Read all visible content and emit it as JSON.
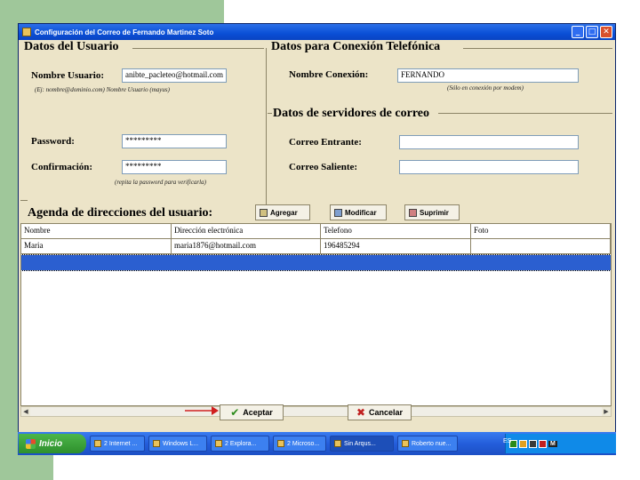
{
  "window": {
    "title": "Configuración del Correo de Fernando Martinez Soto",
    "buttons": {
      "minimize": "_",
      "maximize": "□",
      "close": "✕"
    }
  },
  "usuario": {
    "section_title": "Datos del Usuario",
    "nombre_label": "Nombre Usuario:",
    "nombre_value": "anibte_pacleteo@hotmail.com",
    "nombre_hint": "(Ej: nombre@dominio.com)          Nombre Usuario (mayus)",
    "password_label": "Password:",
    "password_value": "*********",
    "confirm_label": "Confirmación:",
    "confirm_value": "*********",
    "confirm_hint": "(repita la password para verificarla)"
  },
  "conexion": {
    "section_title": "Datos para Conexión Telefónica",
    "nombre_label": "Nombre Conexión:",
    "nombre_value": "FERNANDO",
    "nombre_hint": "(Sólo en conexión por modem)"
  },
  "servidores": {
    "section_title": "Datos de servidores de correo",
    "entrante_label": "Correo Entrante:",
    "entrante_value": "",
    "saliente_label": "Correo Saliente:",
    "saliente_value": ""
  },
  "agenda": {
    "title": "Agenda de direcciones del usuario:",
    "add_label": "Agregar",
    "edit_label": "Modificar",
    "delete_label": "Suprimir",
    "columns": [
      "Nombre",
      "Dirección electrónica",
      "Telefono",
      "Foto"
    ],
    "rows": [
      [
        "Maria",
        "maria1876@hotmail.com",
        "196485294",
        ""
      ]
    ]
  },
  "actions": {
    "ok_label": "Aceptar",
    "cancel_label": "Cancelar"
  },
  "taskbar": {
    "start_label": "Inicio",
    "tasks": [
      "2 Internet ...",
      "Windows L...",
      "2 Explora...",
      "2 Microso...",
      "Sin Arqus...",
      "Roberto nue..."
    ],
    "language": "ES",
    "tray": [
      "M"
    ]
  },
  "colors": {
    "titlebar": "#0a4fd6",
    "selection": "#2b5fd0",
    "window_bg": "#ece4c8",
    "arrow": "#d02020"
  }
}
